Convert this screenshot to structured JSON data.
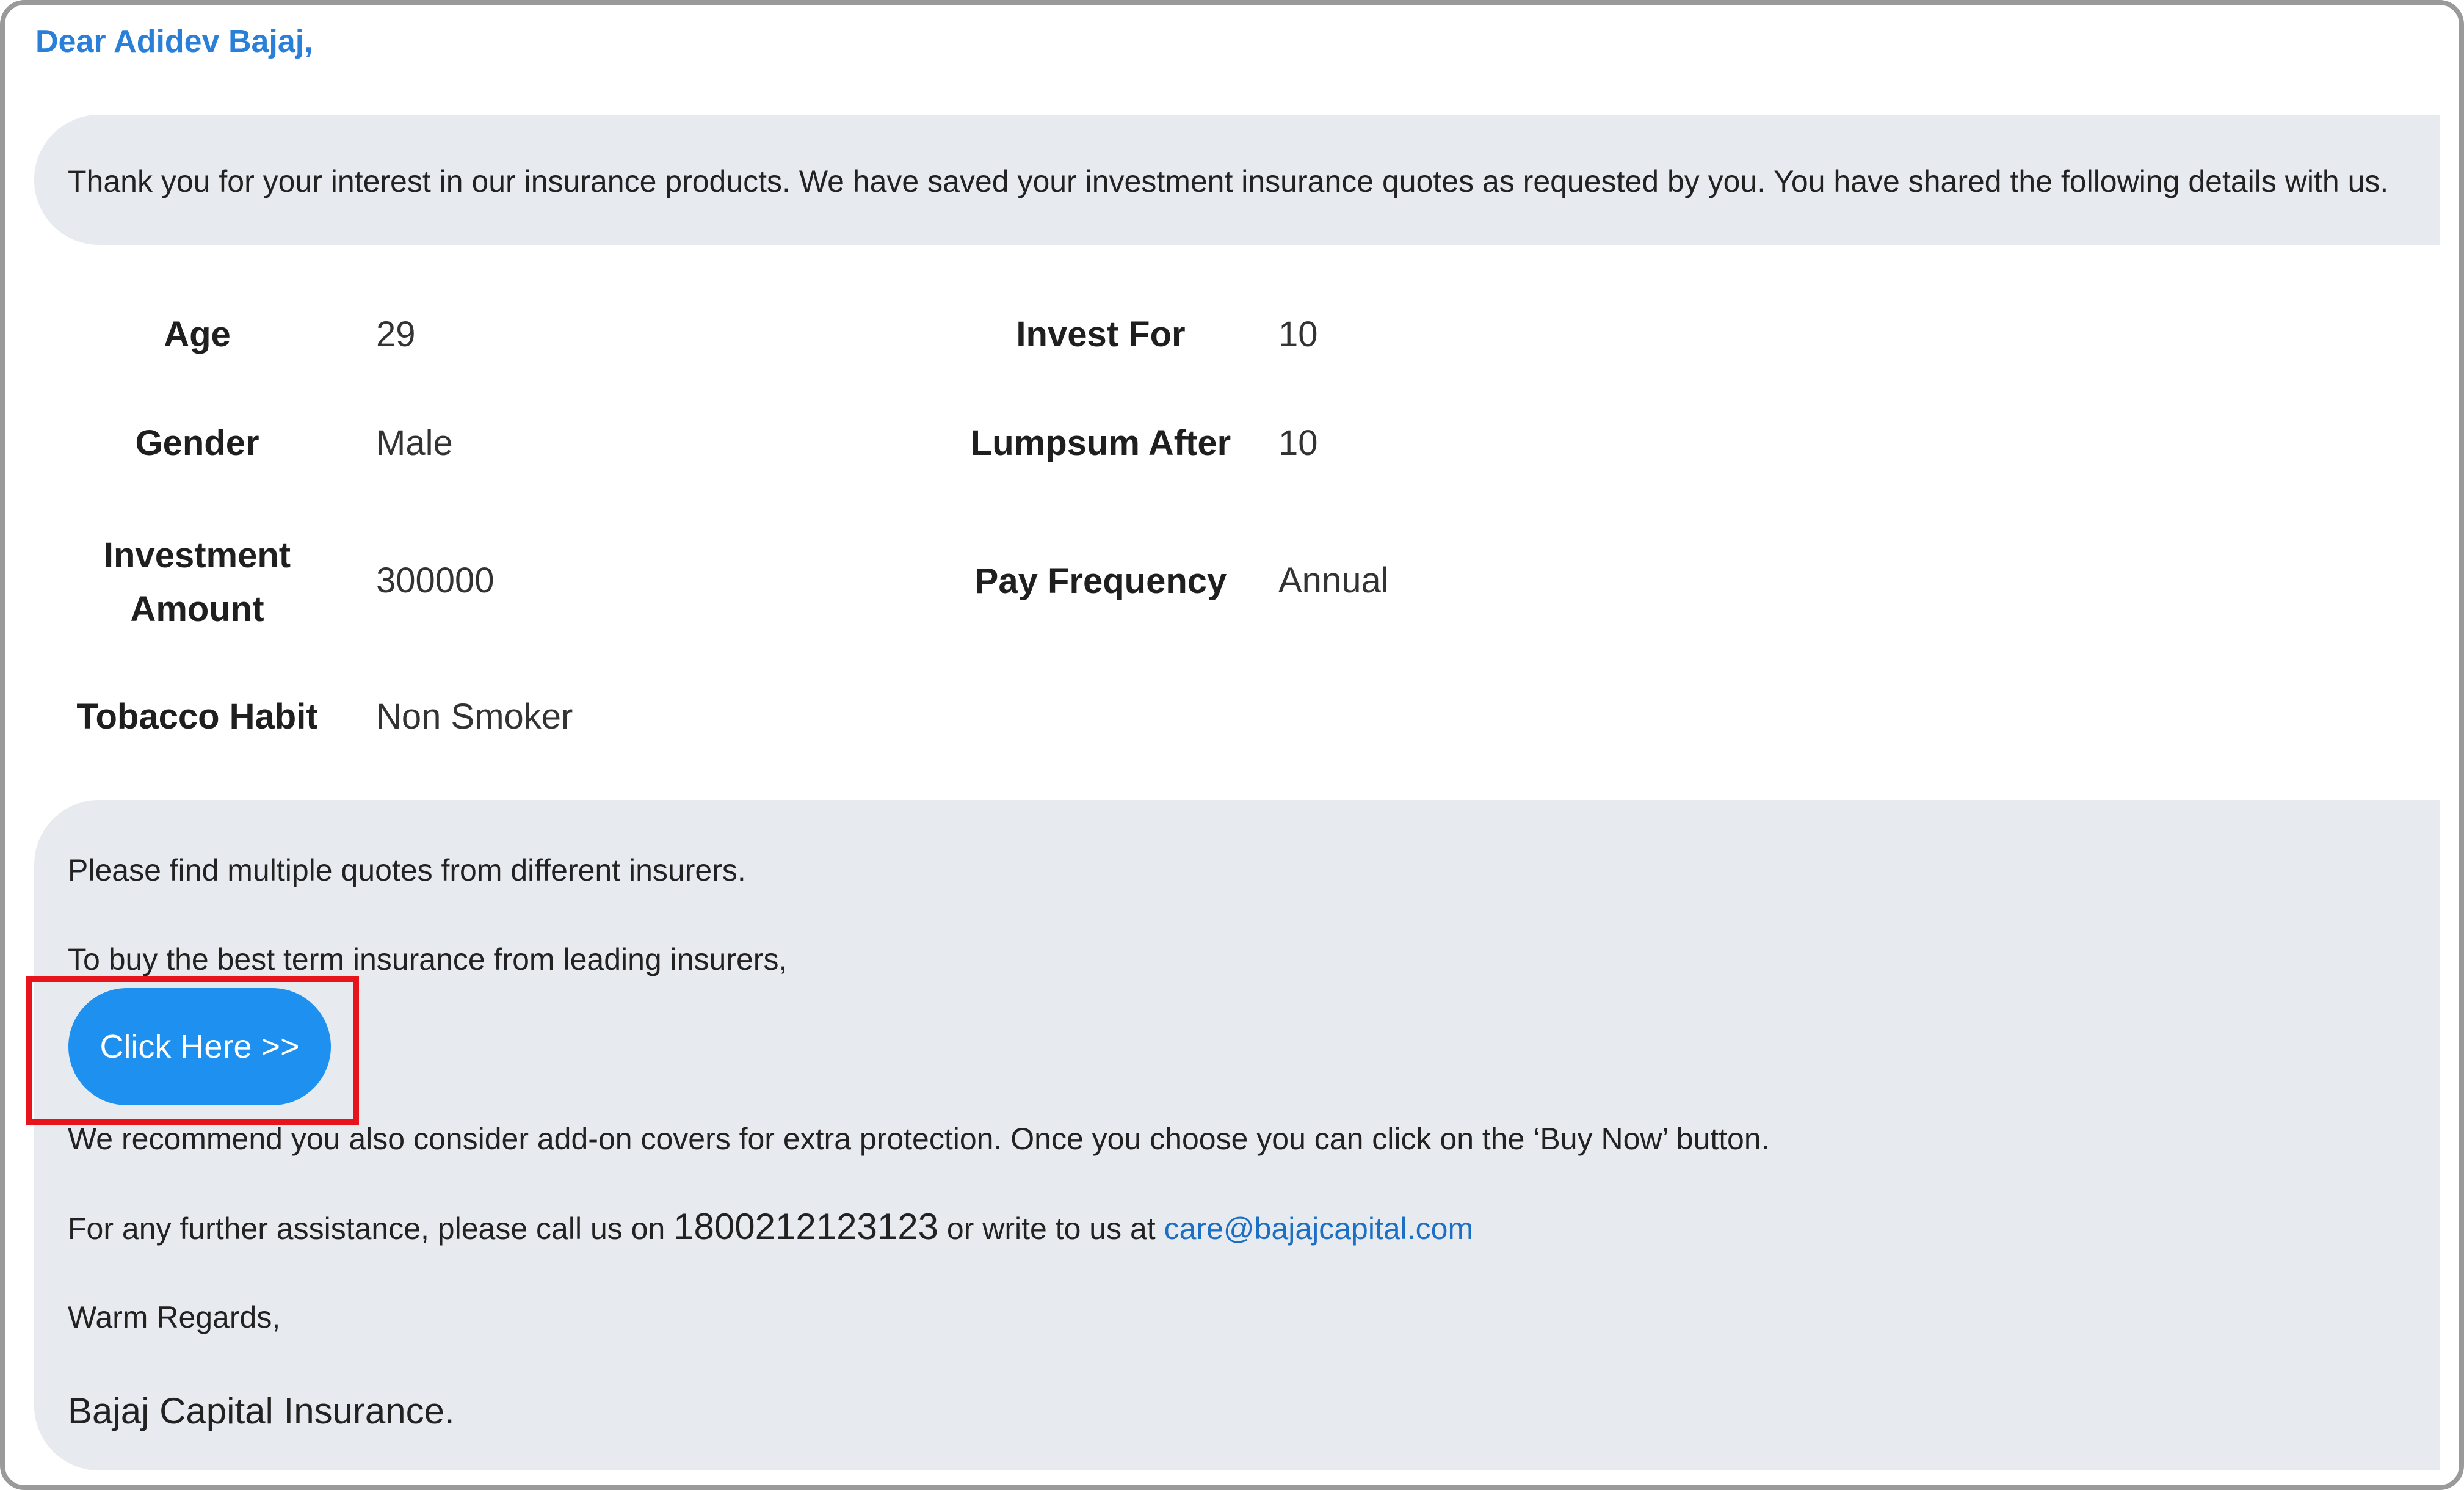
{
  "greeting": "Dear Adidev Bajaj,",
  "intro": "Thank you for your interest in our insurance products. We have saved your investment insurance quotes as requested by you. You have shared the following details with us.",
  "details": {
    "age_label": "Age",
    "age_value": "29",
    "gender_label": "Gender",
    "gender_value": "Male",
    "investment_label_line1": "Investment",
    "investment_label_line2": "Amount",
    "investment_value": "300000",
    "tobacco_label": "Tobacco Habit",
    "tobacco_value": "Non Smoker",
    "invest_for_label": "Invest For",
    "invest_for_value": "10",
    "lumpsum_label": "Lumpsum After",
    "lumpsum_value": "10",
    "frequency_label": "Pay Frequency",
    "frequency_value": "Annual"
  },
  "quotes": {
    "line1": "Please find multiple quotes from different insurers.",
    "line2": "To buy the best term insurance from leading insurers,",
    "button_label": "Click Here >>",
    "line3": "We recommend you also consider add-on covers for extra protection. Once you choose you can click on the ‘Buy Now’ button.",
    "assist_prefix": "For any further assistance, please call us on ",
    "phone": "1800212123123",
    "assist_middle": " or write to us at ",
    "email": "care@bajajcapital.com",
    "regards": "Warm Regards,",
    "signature": "Bajaj Capital Insurance."
  },
  "colors": {
    "greeting": "#2a7fd8",
    "panel_bg": "#e7eaee",
    "button_bg": "#1e90f0",
    "highlight_border": "#e8141b",
    "link": "#1b6fc4"
  }
}
